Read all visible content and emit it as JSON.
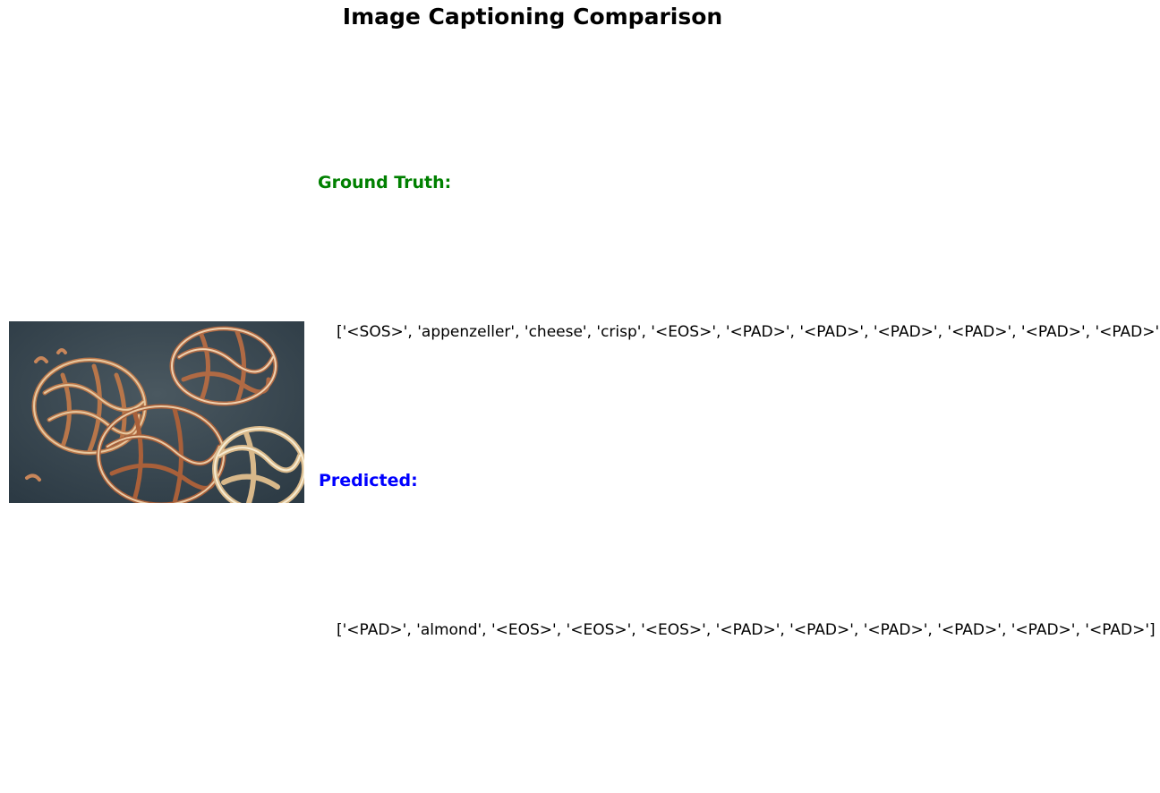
{
  "title": "Image Captioning Comparison",
  "image": {
    "subject": "fried-dough-rings-icon"
  },
  "ground_truth": {
    "label": "Ground Truth:",
    "color": "#008000",
    "tokens_text": "['<SOS>', 'appenzeller', 'cheese', 'crisp', '<EOS>', '<PAD>', '<PAD>', '<PAD>', '<PAD>', '<PAD>', '<PAD>']"
  },
  "predicted": {
    "label": "Predicted:",
    "color": "#0000ff",
    "tokens_text": "['<PAD>', 'almond', '<EOS>', '<EOS>', '<EOS>', '<PAD>', '<PAD>', '<PAD>', '<PAD>', '<PAD>', '<PAD>']"
  }
}
